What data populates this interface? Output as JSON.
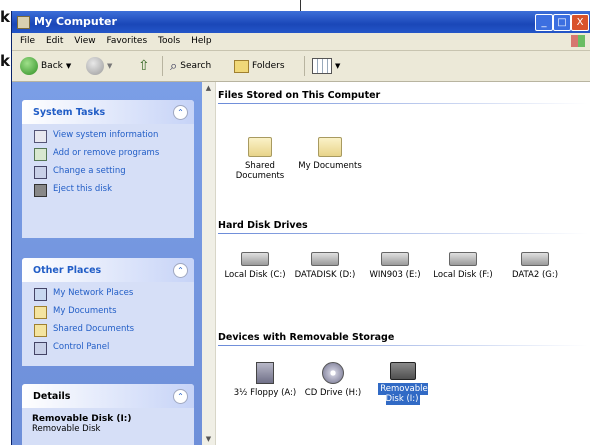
{
  "edge": {
    "line1": "k",
    "line2": "k"
  },
  "window": {
    "title": "My Computer",
    "controls": {
      "minimize": "_",
      "maximize": "□",
      "close": "X"
    }
  },
  "menu": [
    "File",
    "Edit",
    "View",
    "Favorites",
    "Tools",
    "Help"
  ],
  "toolbar": {
    "back": "Back",
    "search": "Search",
    "folders": "Folders"
  },
  "left_pane": {
    "system_tasks": {
      "title": "System Tasks",
      "items": [
        "View system information",
        "Add or remove programs",
        "Change a setting",
        "Eject this disk"
      ]
    },
    "other_places": {
      "title": "Other Places",
      "items": [
        "My Network Places",
        "My Documents",
        "Shared Documents",
        "Control Panel"
      ]
    },
    "details": {
      "title": "Details",
      "name": "Removable Disk (I:)",
      "type": "Removable Disk"
    }
  },
  "right_pane": {
    "files_group": {
      "title": "Files Stored on This Computer",
      "items": [
        "Shared Documents",
        "My Documents"
      ]
    },
    "hdd_group": {
      "title": "Hard Disk Drives",
      "items": [
        "Local Disk (C:)",
        "DATADISK (D:)",
        "WIN903 (E:)",
        "Local Disk (F:)",
        "DATA2 (G:)"
      ]
    },
    "removable_group": {
      "title": "Devices with Removable Storage",
      "items": [
        "3½ Floppy (A:)",
        "CD Drive (H:)",
        "Removable Disk (I:)"
      ]
    }
  }
}
